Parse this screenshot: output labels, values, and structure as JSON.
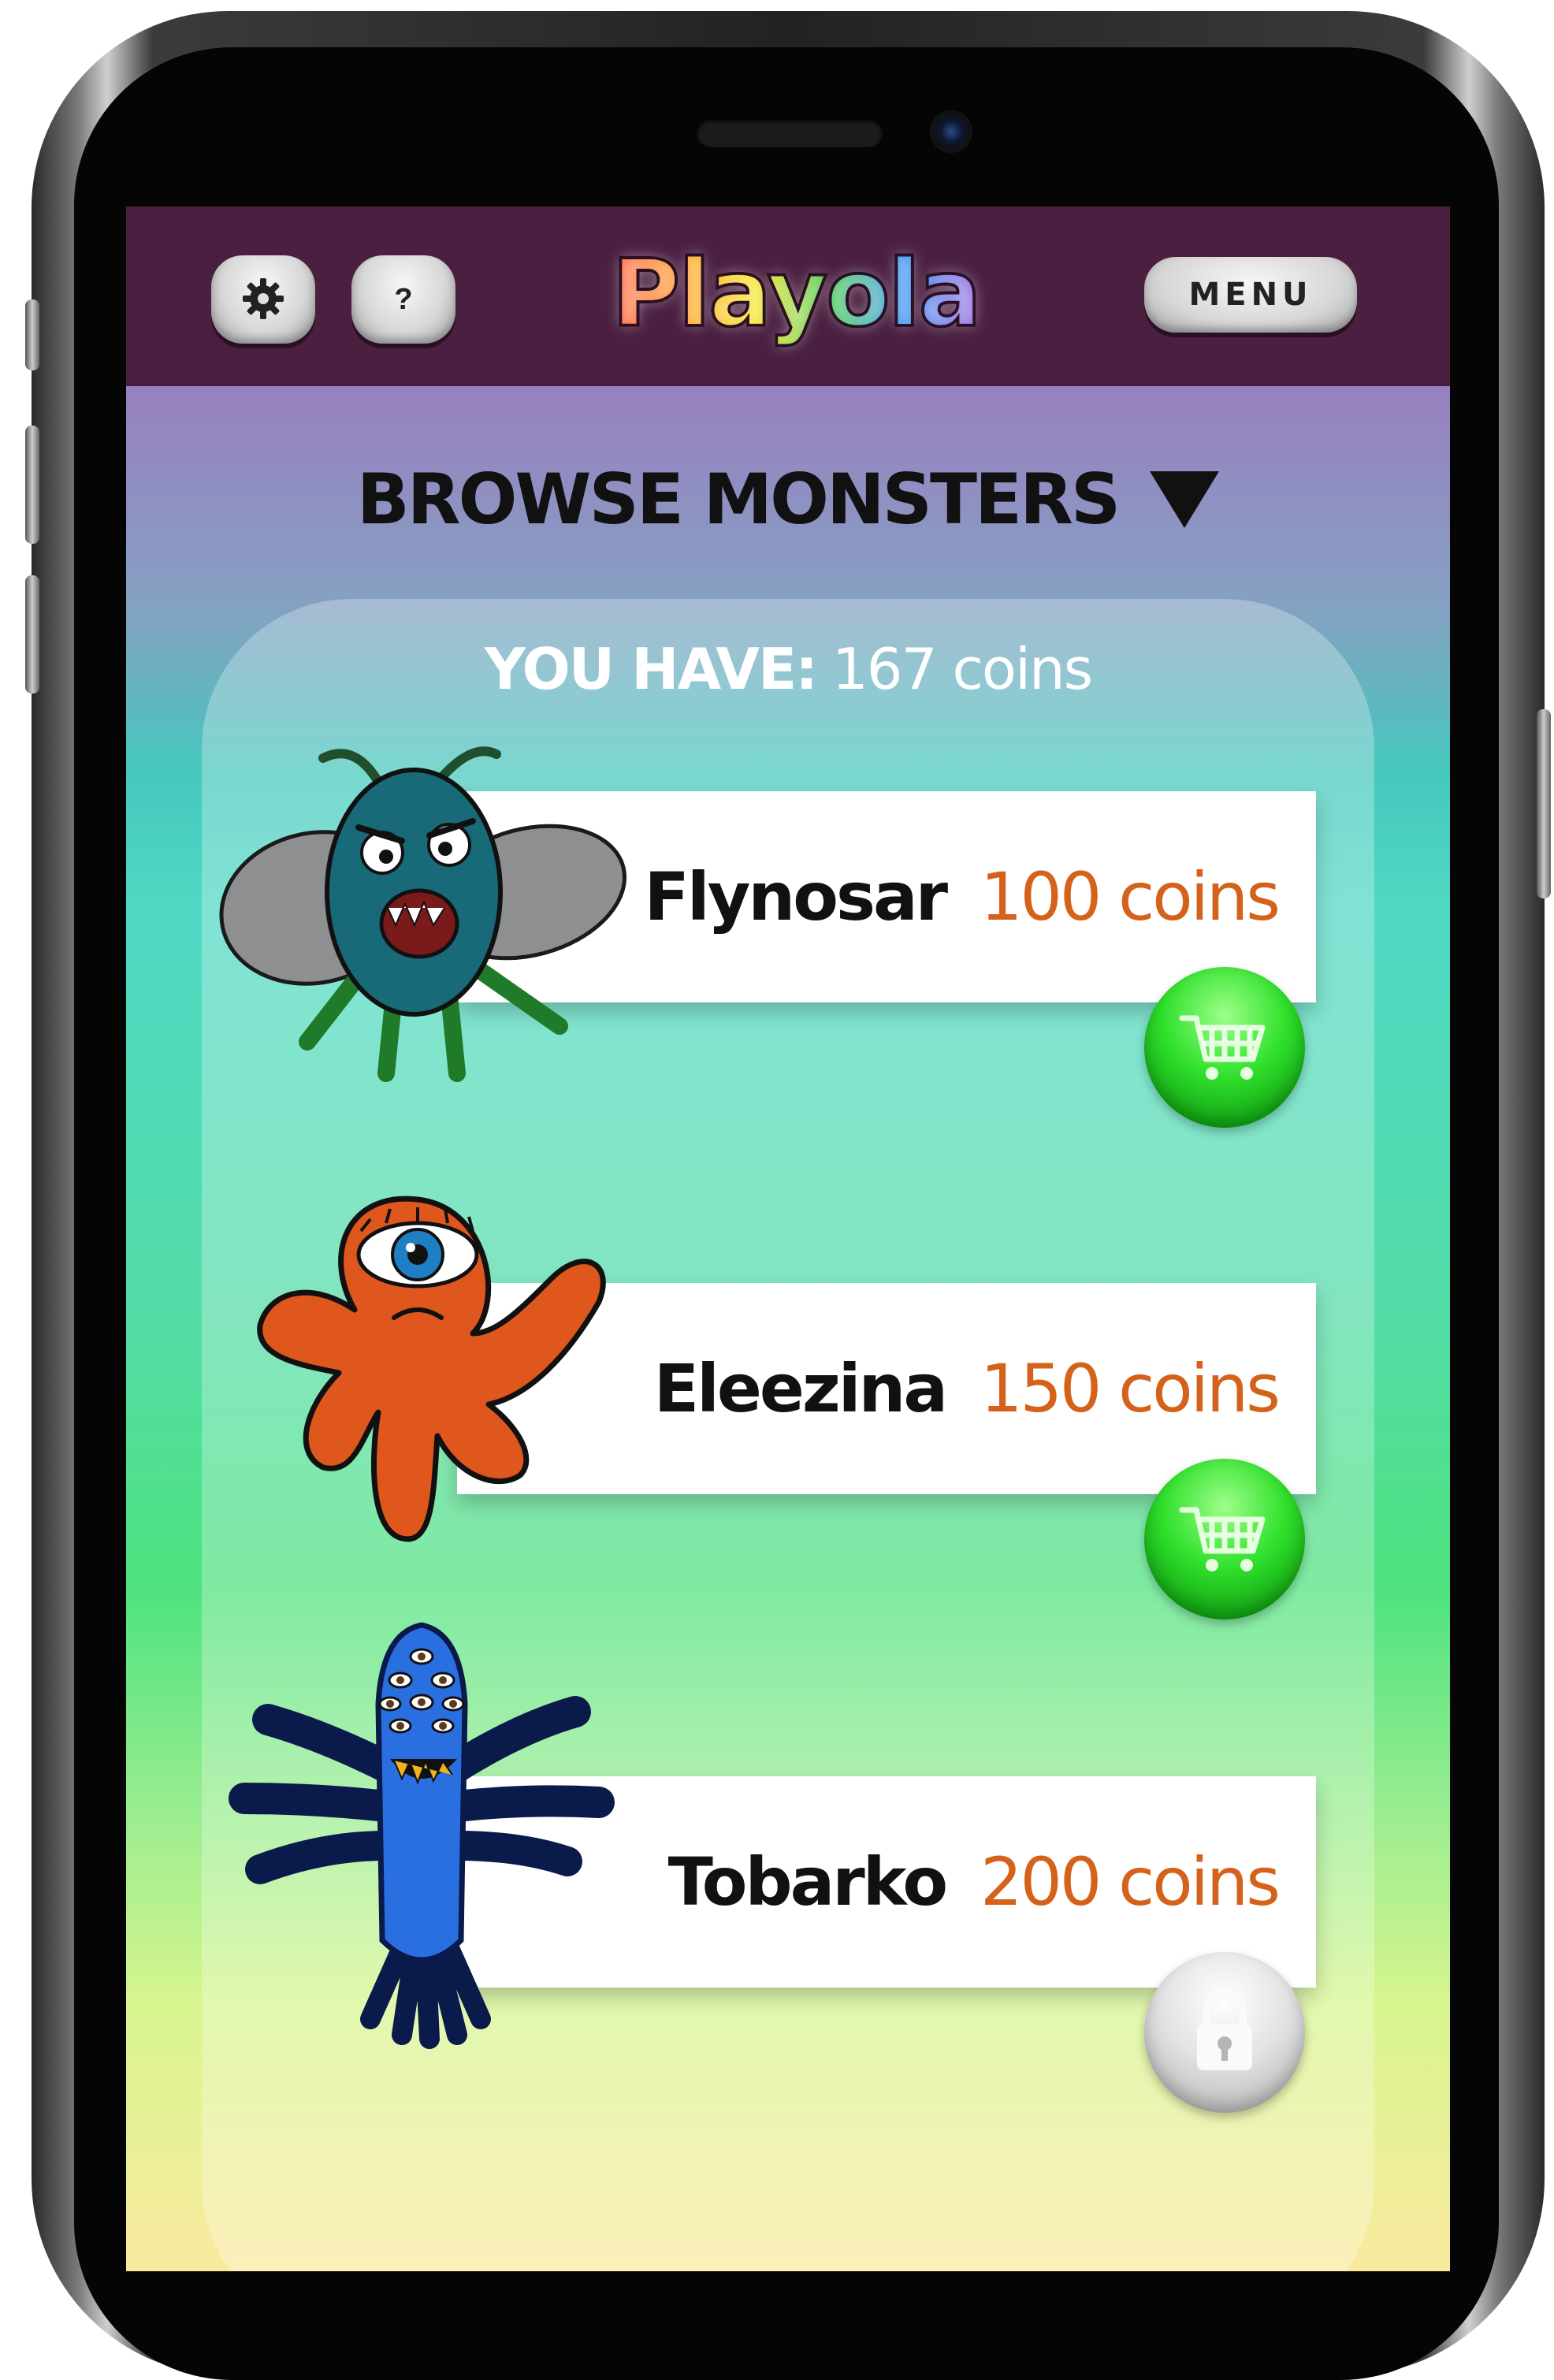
{
  "header": {
    "logo_text": "Playola",
    "help_label": "?",
    "menu_label": "MENU",
    "settings_icon": "gear-icon",
    "colors": {
      "bar": "#4a1f40"
    }
  },
  "store": {
    "title": "BROWSE MONSTERS",
    "dropdown_icon": "triangle-down-icon",
    "balance_label": "YOU HAVE:",
    "balance_value": "167 coins"
  },
  "monsters": [
    {
      "name": "Flynosar",
      "price": "100 coins",
      "action": "buy",
      "action_icon": "shopping-cart-icon"
    },
    {
      "name": "Eleezina",
      "price": "150 coins",
      "action": "buy",
      "action_icon": "shopping-cart-icon"
    },
    {
      "name": "Tobarko",
      "price": "200 coins",
      "action": "locked",
      "action_icon": "lock-icon"
    }
  ],
  "colors": {
    "price": "#d4621a",
    "buy_button": "#2fe02b",
    "locked_button": "#c8c8c8"
  }
}
